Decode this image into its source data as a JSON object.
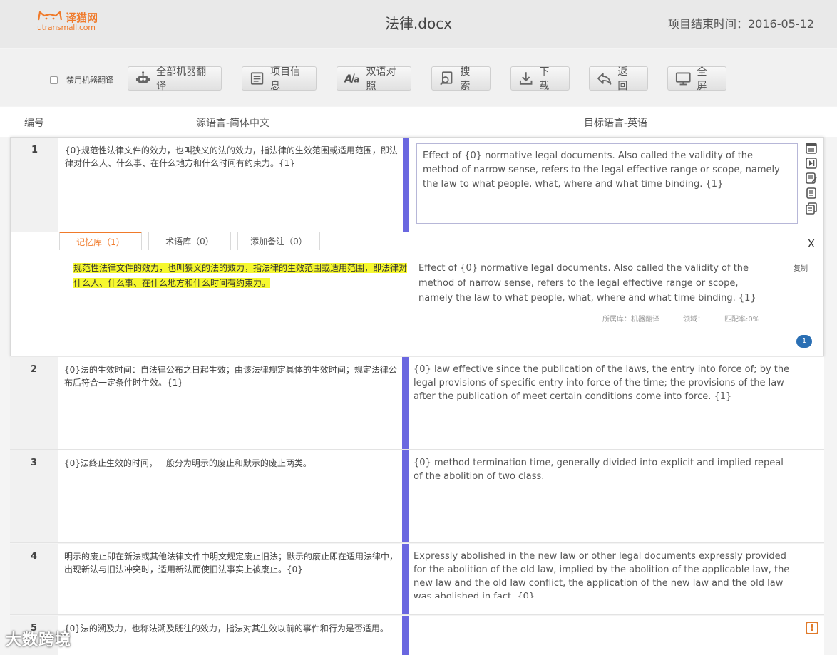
{
  "header": {
    "logo_cn": "译猫网",
    "logo_en": "utransmall.com",
    "doc_title": "法律.docx",
    "end_time": "项目结束时间：2016-05-12"
  },
  "toolbar": {
    "disable_mt_label": "禁用机器翻译",
    "buttons": [
      {
        "label": "全部机器翻译",
        "icon": "robot-icon"
      },
      {
        "label": "项目信息",
        "icon": "document-icon"
      },
      {
        "label": "双语对照",
        "icon": "bilingual-icon"
      },
      {
        "label": "搜 索",
        "icon": "search-icon"
      },
      {
        "label": "下 载",
        "icon": "download-icon"
      },
      {
        "label": "返 回",
        "icon": "back-icon"
      },
      {
        "label": "全 屏",
        "icon": "monitor-icon"
      }
    ]
  },
  "columns": {
    "number": "编号",
    "source": "源语言-简体中文",
    "target": "目标语言-英语"
  },
  "rows": [
    {
      "number": "1",
      "source": "{0}规范性法律文件的效力，也叫狭义的法的效力，指法律的生效范围或适用范围，即法律对什么人、什么事、在什么地方和什么时间有约束力。{1}",
      "target": "Effect of {0} normative legal documents. Also called the validity of the method of narrow sense, refers to the legal effective range or scope, namely the law to what people, what, where and what time binding. {1}"
    },
    {
      "number": "2",
      "source": "{0}法的生效时间：自法律公布之日起生效；由该法律规定具体的生效时间；规定法律公布后符合一定条件时生效。{1}",
      "target": "{0} law effective since the publication of the laws, the entry into force of; by the legal provisions of specific entry into force of the time; the provisions of the law after the publication of meet certain conditions come into force. {1}"
    },
    {
      "number": "3",
      "source": "{0}法终止生效的时间，一般分为明示的废止和默示的废止两类。",
      "target": "{0} method termination time, generally divided into explicit and implied repeal of the abolition of two class."
    },
    {
      "number": "4",
      "source": "明示的废止即在新法或其他法律文件中明文规定废止旧法；默示的废止即在适用法律中，出现新法与旧法冲突时，适用新法而使旧法事实上被废止。{0}",
      "target": "Expressly abolished in the new law or other legal documents expressly provided for the abolition of the old law, implied by the abolition of the applicable law, the new law and the old law conflict, the application of the new law and the old law was abolished in fact. {0}"
    },
    {
      "number": "5",
      "source": "{0}法的溯及力，也称法溯及既往的效力，指法对其生效以前的事件和行为是否适用。",
      "target": ""
    }
  ],
  "panel": {
    "tabs": [
      "记忆库（1）",
      "术语库（0）",
      "添加备注（0）"
    ],
    "close": "X",
    "memory_source": "规范性法律文件的效力，也叫狭义的法的效力，指法律的生效范围或适用范围，即法律对什么人、什么事、在什么地方和什么时间有约束力。",
    "memory_target": "Effect of {0} normative legal documents. Also called the validity of the method of narrow sense, refers to the legal effective range or scope, namely the law to what people, what, where and what time binding. {1}",
    "copy": "复制",
    "meta_source": "所属库：机器翻译",
    "meta_domain": "领域：",
    "meta_match": "匹配率:0%",
    "count_badge": "1"
  },
  "warning_icon": "!",
  "watermark": "大数跨境",
  "colors": {
    "accent_orange": "#f07a2a",
    "divider_purple": "#6a67e0",
    "highlight_yellow": "#f6f82e",
    "badge_blue": "#2a6fb4"
  }
}
